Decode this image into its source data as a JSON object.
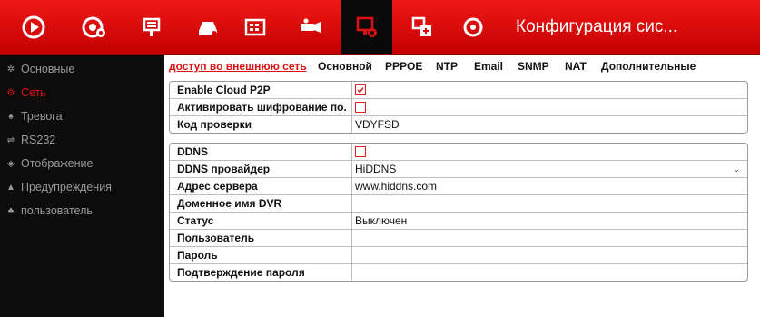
{
  "header": {
    "title": "Конфигурация сис...",
    "icons": [
      {
        "name": "live-view-icon"
      },
      {
        "name": "playback-icon"
      },
      {
        "name": "export-icon"
      },
      {
        "name": "hdd-icon"
      },
      {
        "name": "record-icon"
      },
      {
        "name": "camera-settings-icon"
      },
      {
        "name": "configuration-icon",
        "active": true
      },
      {
        "name": "maintenance-icon"
      },
      {
        "name": "shutdown-icon"
      }
    ]
  },
  "sidebar": {
    "items": [
      {
        "label": "Основные",
        "icon": "gear-icon"
      },
      {
        "label": "Сеть",
        "icon": "network-icon",
        "active": true
      },
      {
        "label": "Тревога",
        "icon": "alarm-icon"
      },
      {
        "label": "RS232",
        "icon": "rs232-icon"
      },
      {
        "label": "Отображение",
        "icon": "display-icon"
      },
      {
        "label": "Предупреждения",
        "icon": "warning-icon"
      },
      {
        "label": "пользователь",
        "icon": "user-icon"
      }
    ]
  },
  "tabs": [
    {
      "label": "доступ во внешнюю сеть",
      "active": true
    },
    {
      "label": "Основной"
    },
    {
      "label": "PPPOE"
    },
    {
      "label": "NTP"
    },
    {
      "label": "Email"
    },
    {
      "label": "SNMP"
    },
    {
      "label": "NAT"
    },
    {
      "label": "Дополнительные"
    }
  ],
  "p2p": {
    "enable_label": "Enable Cloud P2P",
    "enable_checked": true,
    "encrypt_label": "Активировать шифрование по...",
    "encrypt_checked": false,
    "code_label": "Код проверки",
    "code_value": "VDYFSD"
  },
  "ddns": {
    "enable_label": "DDNS",
    "enable_checked": false,
    "provider_label": "DDNS провайдер",
    "provider_value": "HiDDNS",
    "server_label": "Адрес сервера",
    "server_value": "www.hiddns.com",
    "domain_label": "Доменное имя DVR",
    "domain_value": "",
    "status_label": "Статус",
    "status_value": "Выключен",
    "user_label": "Пользователь",
    "user_value": "",
    "password_label": "Пароль",
    "password_value": "",
    "confirm_label": "Подтверждение пароля",
    "confirm_value": ""
  },
  "colors": {
    "accent": "#e01010",
    "topbar": "#d80808",
    "sidebar": "#0c0c0c"
  }
}
